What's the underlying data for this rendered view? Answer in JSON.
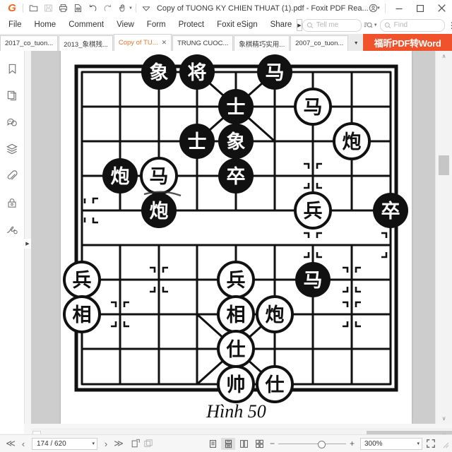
{
  "window": {
    "title": "Copy of TUONG KY CHIEN THUAT (1).pdf - Foxit PDF Rea...",
    "minimize_label": "—",
    "maximize_label": "☐",
    "close_label": "✕",
    "quick_access": [
      {
        "name": "foxit-logo",
        "glyph": "G"
      },
      {
        "name": "open-file-icon"
      },
      {
        "name": "save-icon"
      },
      {
        "name": "print-icon"
      },
      {
        "name": "email-icon"
      },
      {
        "name": "undo-icon"
      },
      {
        "name": "redo-icon"
      },
      {
        "name": "hand-tool-icon"
      },
      {
        "name": "customize-toolbar-icon"
      }
    ]
  },
  "menubar": {
    "items": [
      {
        "label": "File"
      },
      {
        "label": "Home"
      },
      {
        "label": "Comment"
      },
      {
        "label": "View"
      },
      {
        "label": "Form"
      },
      {
        "label": "Protect"
      },
      {
        "label": "Foxit eSign"
      },
      {
        "label": "Share"
      }
    ],
    "overflow_glyph": "▶",
    "tell_me": {
      "placeholder": "Tell me",
      "icon": "search-icon"
    },
    "find": {
      "placeholder": "Find",
      "icon": "search-icon"
    },
    "search_dropdown_icon": "advanced-search-icon",
    "kebab_glyph": "⋮"
  },
  "tabs": {
    "items": [
      {
        "label": "2017_co_tuon...",
        "active": false,
        "closable": false
      },
      {
        "label": "2013_象棋残...",
        "active": false,
        "closable": false
      },
      {
        "label": "Copy of TU...",
        "active": true,
        "closable": true
      },
      {
        "label": "TRUNG CUOC...",
        "active": false,
        "closable": false
      },
      {
        "label": "象棋精巧实用...",
        "active": false,
        "closable": false
      },
      {
        "label": "2007_co_tuon...",
        "active": false,
        "closable": false
      }
    ],
    "close_glyph": "✕",
    "dropdown_glyph": "▼",
    "promo_banner": "福昕PDF转Word"
  },
  "sidebar": {
    "items": [
      {
        "name": "bookmarks-icon",
        "label": "Bookmarks"
      },
      {
        "name": "page-thumbnails-icon",
        "label": "Page Thumbnails"
      },
      {
        "name": "comments-icon",
        "label": "Comments"
      },
      {
        "name": "layers-icon",
        "label": "Layers"
      },
      {
        "name": "attachments-icon",
        "label": "Attachments"
      },
      {
        "name": "security-icon",
        "label": "Security"
      },
      {
        "name": "signatures-icon",
        "label": "Digital Signatures"
      }
    ],
    "expand_glyph": "▶"
  },
  "document": {
    "caption": "Hình 50"
  },
  "statusbar": {
    "first_page_glyph": "≪",
    "prev_page_glyph": "‹",
    "next_page_glyph": "›",
    "last_page_glyph": "≫",
    "page_value": "174 / 620",
    "page_dropdown_glyph": "▾",
    "fit_page_icon": "fit-page-icon",
    "snapshot_icon": "snapshot-icon",
    "view_modes": [
      {
        "name": "single-page-view",
        "active": false
      },
      {
        "name": "continuous-scroll-view",
        "active": true
      },
      {
        "name": "facing-view",
        "active": false
      },
      {
        "name": "facing-continuous-view",
        "active": false
      }
    ],
    "zoom_out_glyph": "−",
    "zoom_in_glyph": "+",
    "zoom_value": "300%",
    "zoom_dropdown_glyph": "▾",
    "fullscreen_icon": "fullscreen-icon"
  },
  "scrollbars": {
    "v_up_glyph": "∧",
    "v_down_glyph": "∨",
    "h_left_glyph": "‹",
    "h_right_glyph": "›"
  },
  "chart_data": {
    "type": "diagram",
    "title": "Hình 50",
    "subject": "Xiangqi (Chinese chess) board position",
    "board": {
      "files": 9,
      "ranks": 10,
      "river": true,
      "palaces": 2
    },
    "pieces": [
      {
        "char": "象",
        "side": "black",
        "file": 2,
        "rank": 0
      },
      {
        "char": "将",
        "side": "black",
        "file": 3,
        "rank": 0
      },
      {
        "char": "马",
        "side": "black",
        "file": 5,
        "rank": 0
      },
      {
        "char": "士",
        "side": "black",
        "file": 4,
        "rank": 1
      },
      {
        "char": "马",
        "side": "red",
        "file": 7,
        "rank": 1
      },
      {
        "char": "士",
        "side": "black",
        "file": 3,
        "rank": 2
      },
      {
        "char": "象",
        "side": "black",
        "file": 4,
        "rank": 2
      },
      {
        "char": "炮",
        "side": "red",
        "file": 8,
        "rank": 2
      },
      {
        "char": "炮",
        "side": "black",
        "file": 1,
        "rank": 3
      },
      {
        "char": "马",
        "side": "red",
        "file": 2,
        "rank": 3
      },
      {
        "char": "卒",
        "side": "black",
        "file": 4,
        "rank": 3
      },
      {
        "char": "炮",
        "side": "black",
        "file": 2,
        "rank": 4
      },
      {
        "char": "兵",
        "side": "red",
        "file": 7,
        "rank": 4
      },
      {
        "char": "卒",
        "side": "black",
        "file": 9,
        "rank": 4
      },
      {
        "char": "兵",
        "side": "red",
        "file": 0,
        "rank": 6
      },
      {
        "char": "兵",
        "side": "red",
        "file": 4,
        "rank": 6
      },
      {
        "char": "马",
        "side": "black",
        "file": 6,
        "rank": 6
      },
      {
        "char": "相",
        "side": "red",
        "file": 0,
        "rank": 7
      },
      {
        "char": "相",
        "side": "red",
        "file": 4,
        "rank": 7
      },
      {
        "char": "炮",
        "side": "red",
        "file": 5,
        "rank": 7
      },
      {
        "char": "仕",
        "side": "red",
        "file": 4,
        "rank": 8
      },
      {
        "char": "帅",
        "side": "red",
        "file": 4,
        "rank": 9
      },
      {
        "char": "仕",
        "side": "red",
        "file": 5,
        "rank": 9
      }
    ]
  }
}
